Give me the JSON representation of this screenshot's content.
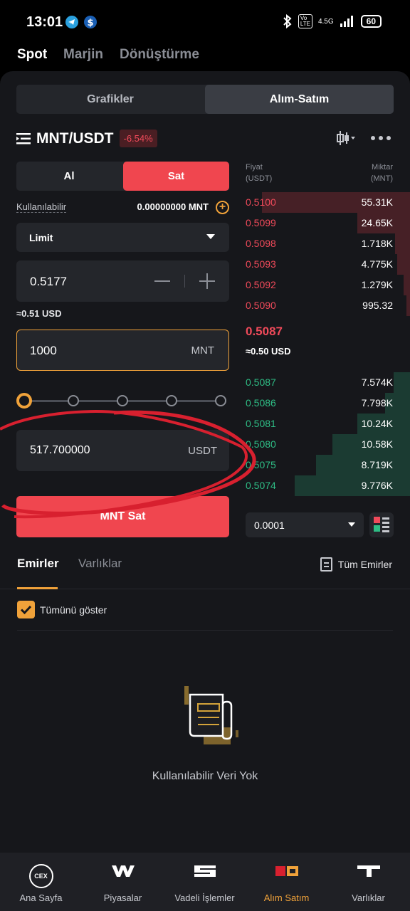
{
  "status": {
    "time": "13:01",
    "network": "4.5G",
    "battery": "60"
  },
  "topnav": {
    "tabs": [
      "Spot",
      "Marjin",
      "Dönüştürme"
    ],
    "active": "Spot"
  },
  "segment": {
    "tabs": [
      "Grafikler",
      "Alım-Satım"
    ],
    "active": "Alım-Satım"
  },
  "pair": {
    "name": "MNT/USDT",
    "change": "-6.54%"
  },
  "form": {
    "buy_label": "Al",
    "sell_label": "Sat",
    "available_label": "Kullanılabilir",
    "available_value": "0.00000000 MNT",
    "order_type": "Limit",
    "price": "0.5177",
    "price_usd": "≈0.51 USD",
    "amount": "1000",
    "amount_unit": "MNT",
    "total": "517.700000",
    "total_unit": "USDT",
    "slider_percent": 0,
    "submit_label": "MNT Sat"
  },
  "orderbook": {
    "price_header": "Fiyat",
    "price_header_unit": "(USDT)",
    "qty_header": "Miktar",
    "qty_header_unit": "(MNT)",
    "asks": [
      {
        "price": "0.5100",
        "qty": "55.31K",
        "depth": 0.9
      },
      {
        "price": "0.5099",
        "qty": "24.65K",
        "depth": 0.32
      },
      {
        "price": "0.5098",
        "qty": "1.718K",
        "depth": 0.09
      },
      {
        "price": "0.5093",
        "qty": "4.775K",
        "depth": 0.08
      },
      {
        "price": "0.5092",
        "qty": "1.279K",
        "depth": 0.04
      },
      {
        "price": "0.5090",
        "qty": "995.32",
        "depth": 0.02
      }
    ],
    "last_price": "0.5087",
    "last_price_usd": "≈0.50 USD",
    "bids": [
      {
        "price": "0.5087",
        "qty": "7.574K",
        "depth": 0.1
      },
      {
        "price": "0.5086",
        "qty": "7.798K",
        "depth": 0.15
      },
      {
        "price": "0.5081",
        "qty": "10.24K",
        "depth": 0.32
      },
      {
        "price": "0.5080",
        "qty": "10.58K",
        "depth": 0.47
      },
      {
        "price": "0.5075",
        "qty": "8.719K",
        "depth": 0.57
      },
      {
        "price": "0.5074",
        "qty": "9.776K",
        "depth": 0.7
      }
    ],
    "precision": "0.0001"
  },
  "orders": {
    "tabs": [
      "Emirler",
      "Varlıklar"
    ],
    "active": "Emirler",
    "all_orders_label": "Tüm Emirler",
    "show_all_label": "Tümünü göster",
    "show_all_checked": true,
    "empty_text": "Kullanılabilir Veri Yok"
  },
  "bottomnav": {
    "items": [
      {
        "label": "Ana Sayfa",
        "icon": "cex-icon"
      },
      {
        "label": "Piyasalar",
        "icon": "markets-icon"
      },
      {
        "label": "Vadeli İşlemler",
        "icon": "futures-icon"
      },
      {
        "label": "Alım Satım",
        "icon": "trade-icon"
      },
      {
        "label": "Varlıklar",
        "icon": "assets-icon"
      }
    ],
    "active": "Alım Satım",
    "cex_text": "CEX"
  },
  "colors": {
    "accent": "#f0a23a",
    "sell": "#f0464f",
    "buy": "#2ebd85",
    "bg": "#16171b"
  }
}
